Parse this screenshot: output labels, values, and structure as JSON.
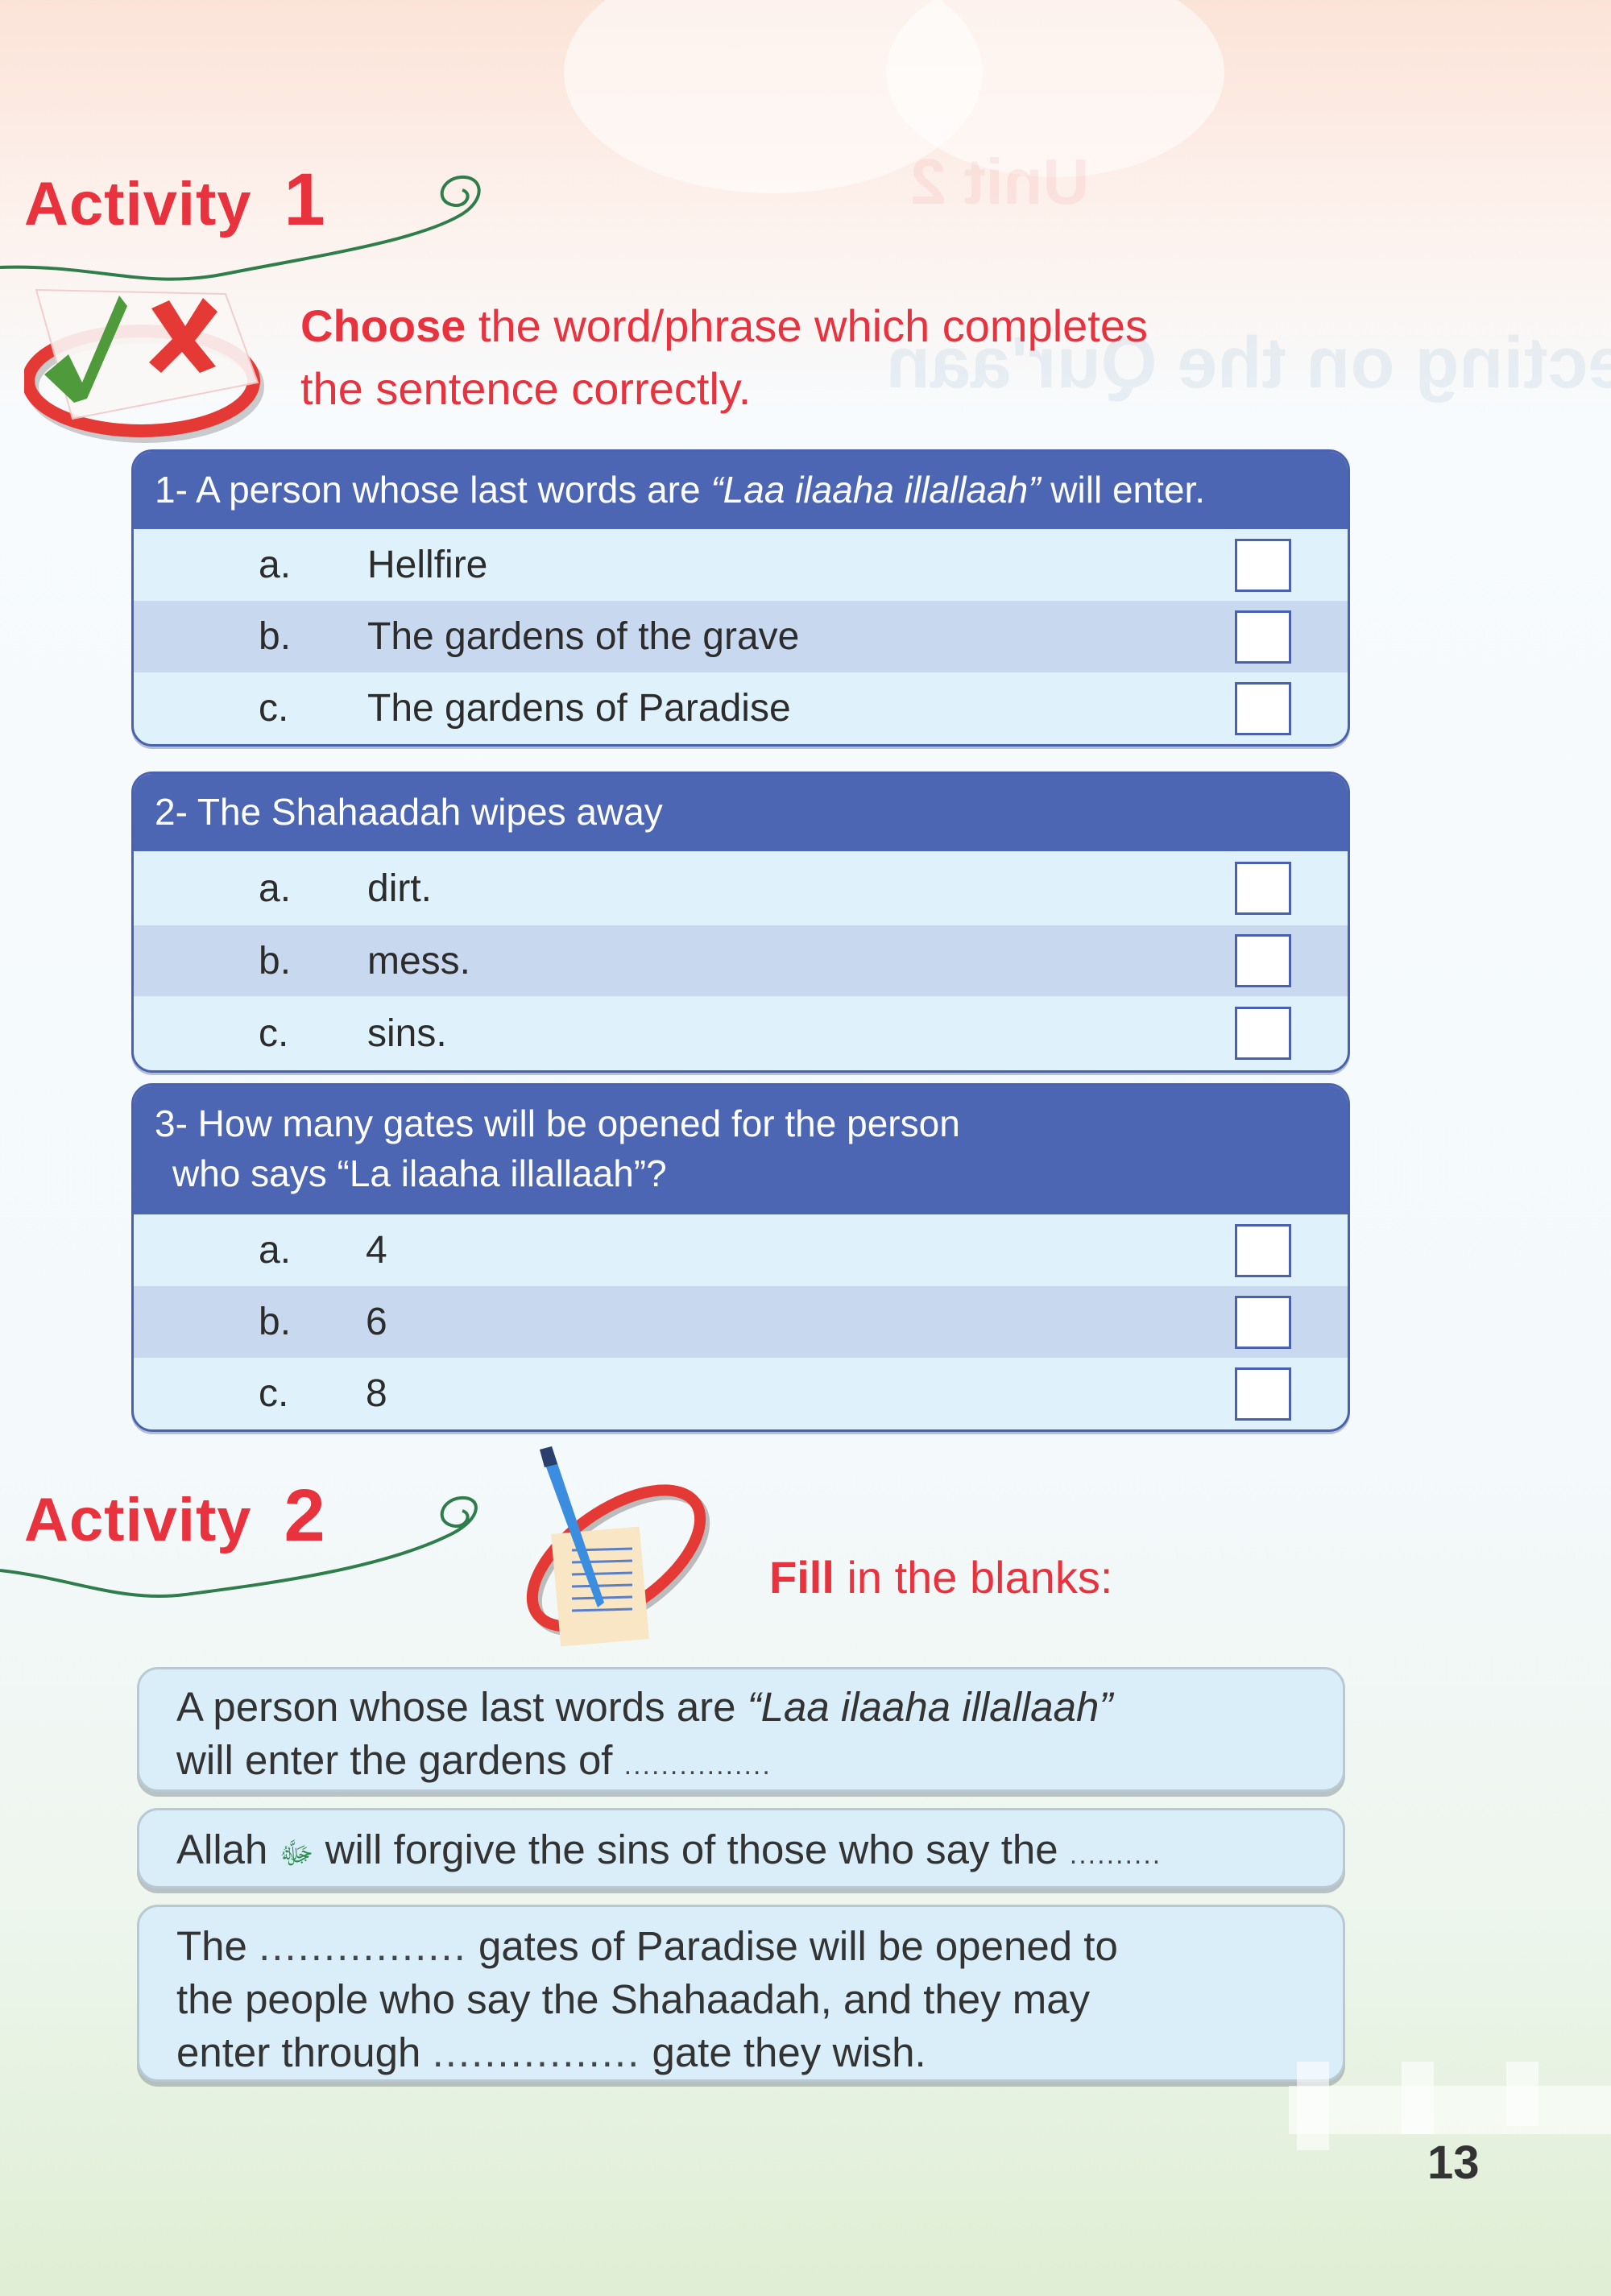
{
  "activity1": {
    "label": "Activity",
    "number": "1",
    "instruction_bold": "Choose",
    "instruction_line1": " the word/phrase which completes",
    "instruction_line2": "the sentence correctly.",
    "questions": [
      {
        "prefix": "1- A person whose last words are ",
        "italic": "“Laa ilaaha illallaah”",
        "suffix": " will enter.",
        "options": [
          {
            "letter": "a.",
            "text": "Hellfire",
            "checked": false
          },
          {
            "letter": "b.",
            "text": "The gardens of the grave",
            "checked": false
          },
          {
            "letter": "c.",
            "text": "The gardens of Paradise",
            "checked": false
          }
        ]
      },
      {
        "prefix": "2- The Shahaadah wipes away",
        "italic": "",
        "suffix": "",
        "options": [
          {
            "letter": "a.",
            "text": "dirt.",
            "checked": false
          },
          {
            "letter": "b.",
            "text": "mess.",
            "checked": false
          },
          {
            "letter": "c.",
            "text": "sins.",
            "checked": false
          }
        ]
      },
      {
        "prefix": "3- How many gates will be opened for the person",
        "line2": "who says “La ilaaha illallaah”?",
        "options": [
          {
            "letter": "a.",
            "text": "4",
            "checked": false
          },
          {
            "letter": "b.",
            "text": "6",
            "checked": false
          },
          {
            "letter": "c.",
            "text": "8",
            "checked": false
          }
        ]
      }
    ]
  },
  "activity2": {
    "label": "Activity",
    "number": "2",
    "instruction_bold": "Fill",
    "instruction_rest": " in the blanks:",
    "items": [
      {
        "part1": "A person whose last words are ",
        "italic": "“Laa ilaaha illallaah”",
        "part2": "will enter the gardens of ",
        "blank": "................"
      },
      {
        "part1": "Allah ",
        "honorific": "ﷻ",
        "part2": " will forgive the sins of those who say the ",
        "blank": ".........."
      },
      {
        "line1_a": "The ",
        "blank1": "................",
        "line1_b": " gates of Paradise will be opened to",
        "line2": "the people who say the Shahaadah, and they may",
        "line3_a": "enter through ",
        "blank2": "................",
        "line3_b": " gate they wish."
      }
    ]
  },
  "page_number": "13",
  "colors": {
    "accent_red": "#e8333f",
    "question_header_blue": "#4c66b3",
    "row_light": "#dff2fb",
    "row_alt": "#c8d8ee",
    "swirl_green": "#2e7d4a"
  }
}
